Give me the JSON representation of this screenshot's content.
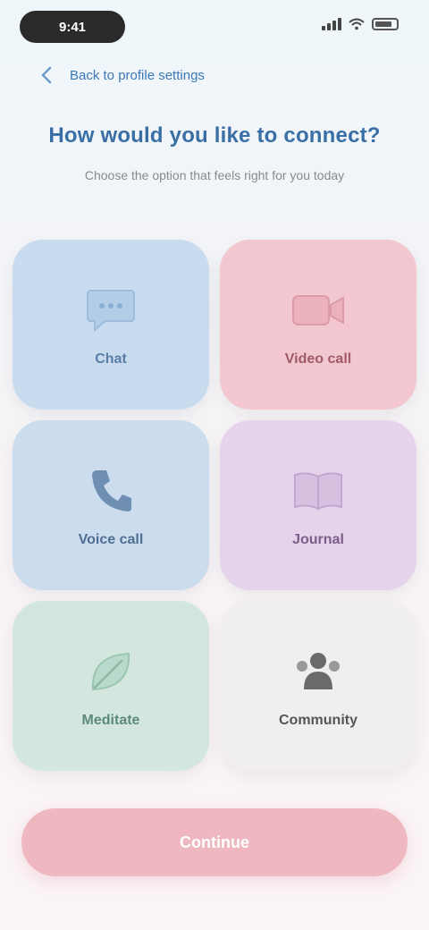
{
  "status_bar": {
    "time": "9:41"
  },
  "nav": {
    "back_label": "Back to profile settings"
  },
  "header": {
    "title": "How would you like to connect?",
    "subtitle": "Choose the option that feels right for you today"
  },
  "tiles": [
    {
      "label": "Chat",
      "icon": "chat-bubble-icon",
      "color": "#c9dcef",
      "text_color": "#5a7fa6"
    },
    {
      "label": "Video call",
      "icon": "video-camera-icon",
      "color": "#f3c7cf",
      "text_color": "#a05a68"
    },
    {
      "label": "Voice call",
      "icon": "phone-icon",
      "color": "#cbdcee",
      "text_color": "#4f6f92"
    },
    {
      "label": "Journal",
      "icon": "book-icon",
      "color": "#e4d3ea",
      "text_color": "#7d5d8a"
    },
    {
      "label": "Meditate",
      "icon": "leaf-icon",
      "color": "#d3e7df",
      "text_color": "#5d8a78"
    },
    {
      "label": "Community",
      "icon": "people-icon",
      "color": "#f1eef1",
      "text_color": "#555555"
    }
  ],
  "actions": {
    "continue_label": "Continue"
  },
  "colors": {
    "accent": "#3a6fa6",
    "button": "#efb8c0"
  }
}
